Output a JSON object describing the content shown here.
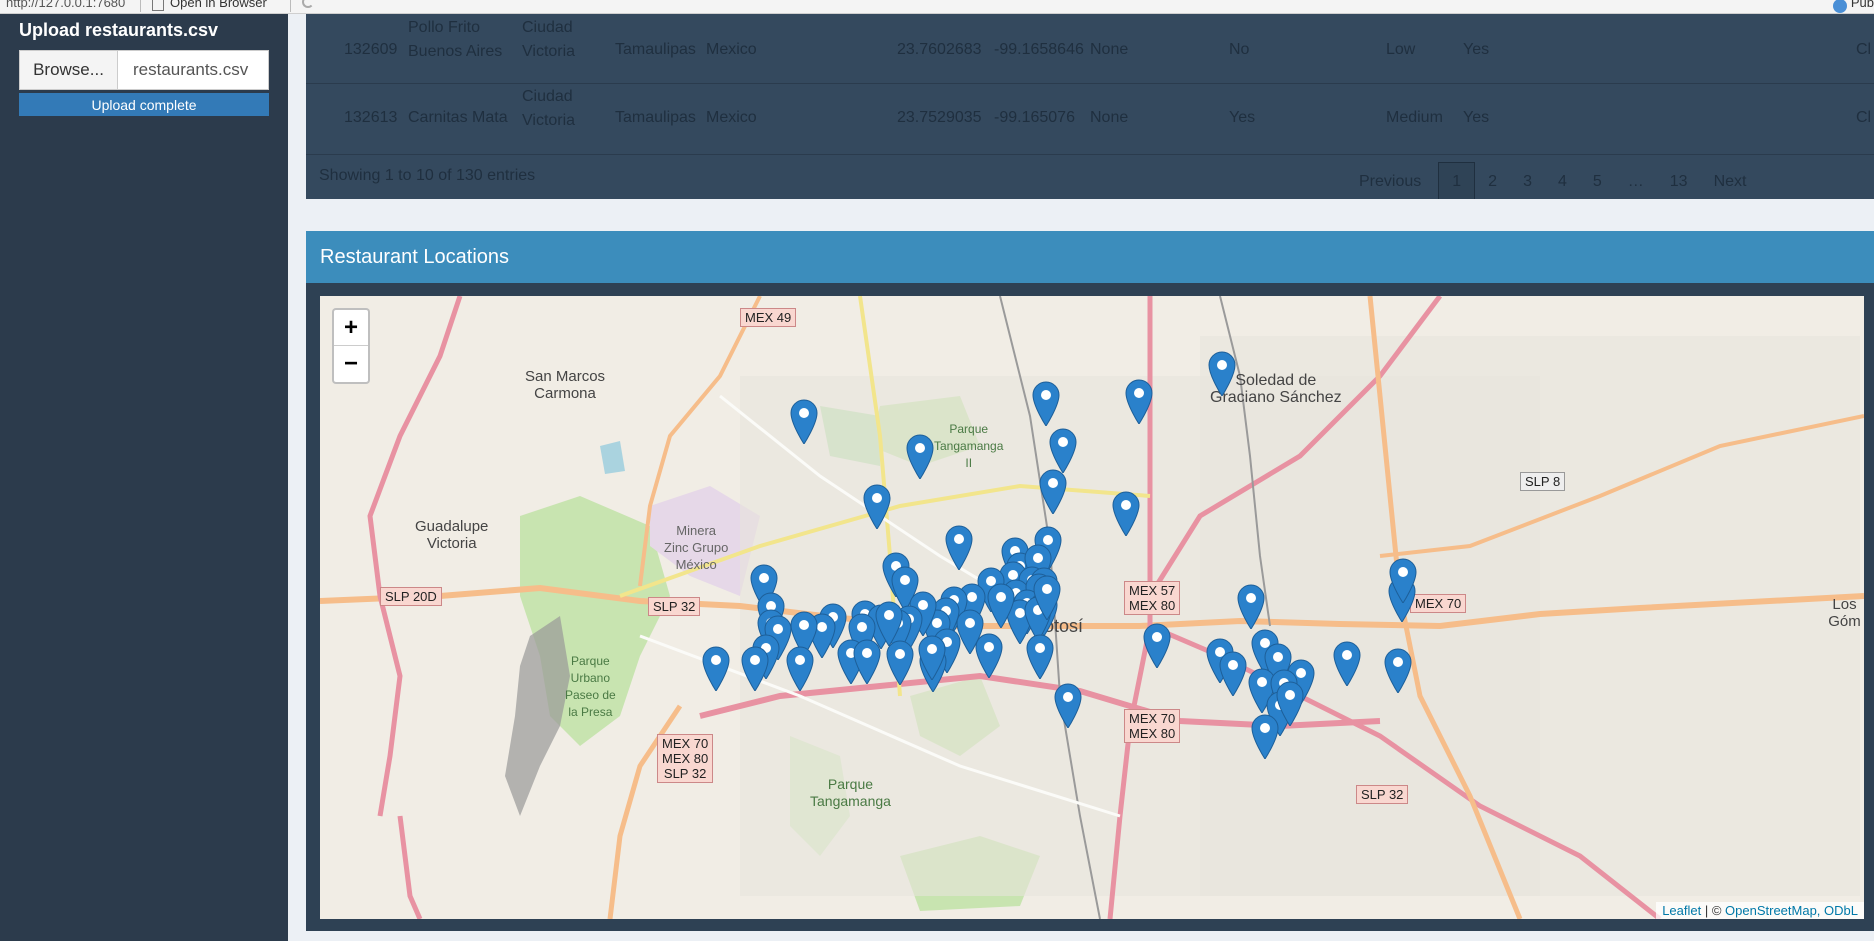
{
  "browser": {
    "url": "http://127.0.0.1:7680",
    "open_in_browser": "Open in Browser",
    "publish": "Pub"
  },
  "sidebar": {
    "upload_title": "Upload restaurants.csv",
    "browse_label": "Browse...",
    "file_name": "restaurants.csv",
    "progress_label": "Upload complete",
    "progress_fraction": 1.0
  },
  "table": {
    "rows": [
      {
        "id": "132609",
        "name": "Pollo Frito Buenos Aires",
        "city": "Ciudad Victoria",
        "state": "Tamaulipas",
        "country": "Mexico",
        "latitude": "23.7602683",
        "longitude": "-99.1658646",
        "alcohol": "None",
        "smoking": "No",
        "price": "Low",
        "area": "Yes",
        "extra": "Cl"
      },
      {
        "id": "132613",
        "name": "Carnitas Mata",
        "city": "Ciudad Victoria",
        "state": "Tamaulipas",
        "country": "Mexico",
        "latitude": "23.7529035",
        "longitude": "-99.165076",
        "alcohol": "None",
        "smoking": "Yes",
        "price": "Medium",
        "area": "Yes",
        "extra": "Cl"
      }
    ],
    "info": "Showing 1 to 10 of 130 entries",
    "pagination": {
      "previous": "Previous",
      "pages": [
        "1",
        "2",
        "3",
        "4",
        "5",
        "…",
        "13"
      ],
      "active": "1",
      "next": "Next"
    }
  },
  "map_box": {
    "title": "Restaurant Locations",
    "zoom_in": "+",
    "zoom_out": "−",
    "attribution_leaflet": "Leaflet",
    "attribution_sep": " | © ",
    "attribution_osm": "OpenStreetMap, ODbL",
    "place_labels": {
      "san_marcos": "San Marcos\nCarmona",
      "soledad": "Soledad de\nGraciano Sánchez",
      "guadalupe": "Guadalupe\nVictoria",
      "minera": "Minera\nZinc Grupo\nMéxico",
      "parque_tangamanga_ii": "Parque\nTangamanga\nII",
      "parque_urbano": "Parque\nUrbano\nPaseo de\nla Presa",
      "parque_tangamanga": "Parque\nTangamanga",
      "potosi": "Potosí",
      "los_gom": "Los Góm"
    },
    "road_shields": {
      "mex49": "MEX 49",
      "slp20d": "SLP 20D",
      "slp32_a": "SLP 32",
      "mex57_80": "MEX 57\nMEX 80",
      "mex70": "MEX 70",
      "slp8": "SLP 8",
      "mex70_80": "MEX 70\nMEX 80",
      "mex70_80_slp32": "MEX 70\nMEX 80\nSLP 32",
      "slp32_b": "SLP 32"
    },
    "marker_count": 76,
    "marker_color": "#2a81cb"
  }
}
